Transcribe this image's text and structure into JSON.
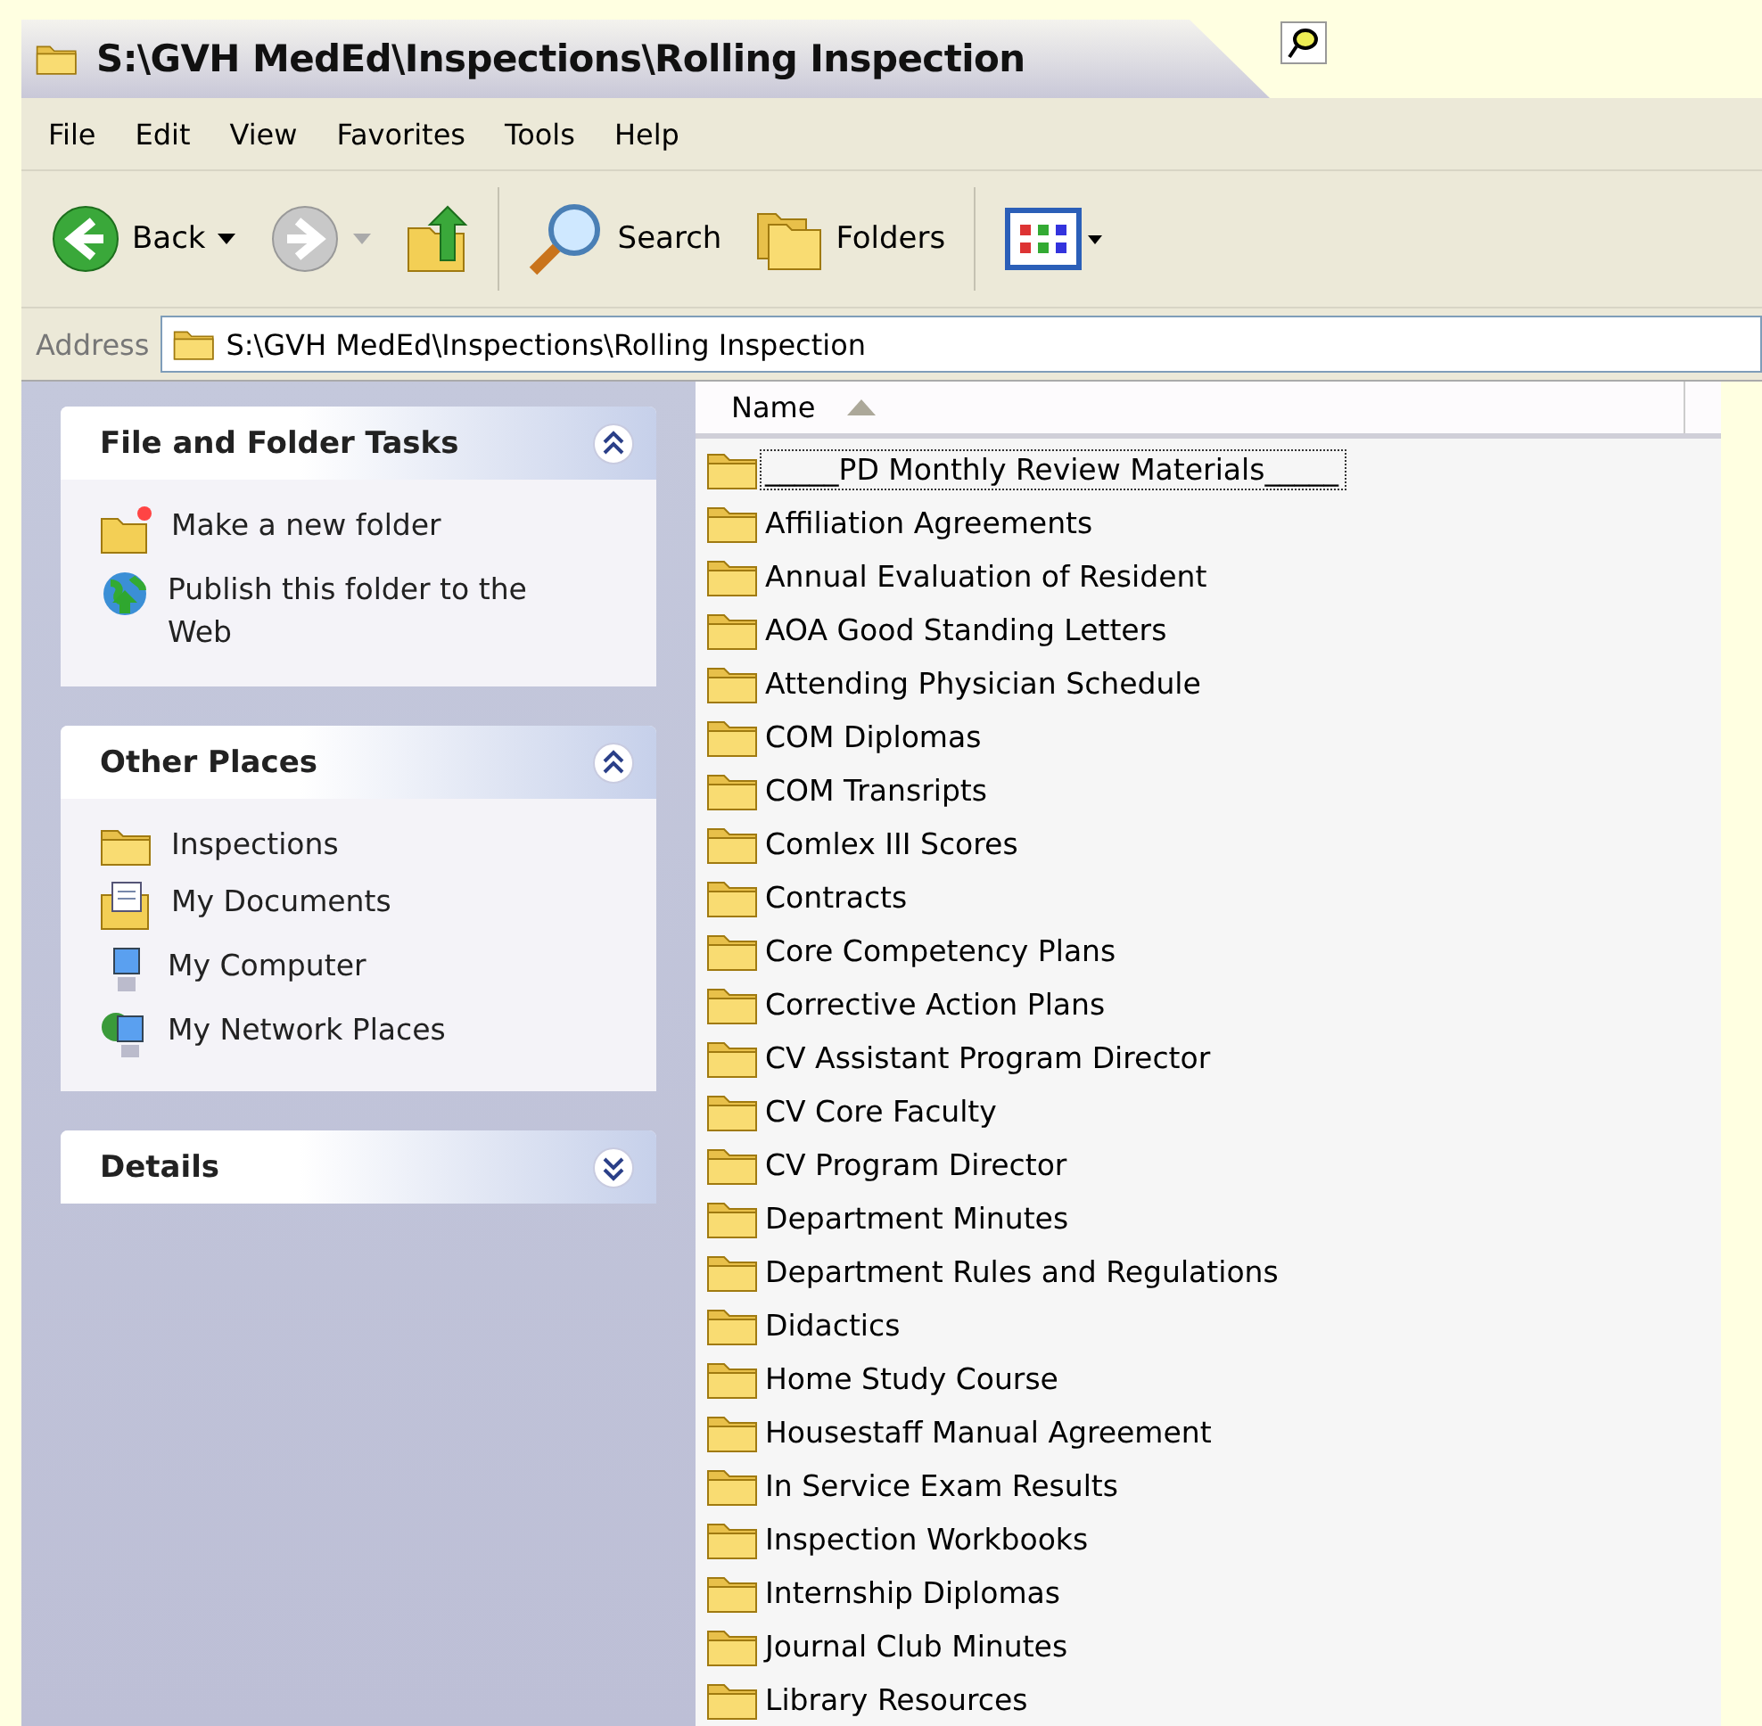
{
  "window": {
    "title": "S:\\GVH MedEd\\Inspections\\Rolling Inspection"
  },
  "menu": [
    "File",
    "Edit",
    "View",
    "Favorites",
    "Tools",
    "Help"
  ],
  "toolbar": [
    {
      "kind": "back",
      "label": "Back"
    },
    {
      "kind": "forward"
    },
    {
      "kind": "up"
    },
    {
      "kind": "search",
      "label": "Search"
    },
    {
      "kind": "folders",
      "label": "Folders"
    },
    {
      "kind": "views"
    }
  ],
  "address": {
    "label": "Address",
    "value": "S:\\GVH MedEd\\Inspections\\Rolling Inspection"
  },
  "panels": [
    {
      "title": "File and Folder Tasks",
      "expanded": true,
      "items": [
        {
          "kind": "newfolder",
          "label": "Make a new folder"
        },
        {
          "kind": "publish",
          "label": "Publish this folder to the Web"
        }
      ]
    },
    {
      "title": "Other Places",
      "expanded": true,
      "items": [
        {
          "kind": "folder",
          "label": "Inspections"
        },
        {
          "kind": "documents",
          "label": "My Documents"
        },
        {
          "kind": "computer",
          "label": "My Computer"
        },
        {
          "kind": "network",
          "label": "My Network Places"
        }
      ]
    },
    {
      "title": "Details",
      "expanded": false
    }
  ],
  "list": {
    "column": "Name",
    "sort_ascending": true,
    "items": [
      {
        "name": "_____PD Monthly Review Materials_____",
        "focused": true
      },
      {
        "name": "Affiliation Agreements",
        "focused": false
      },
      {
        "name": "Annual Evaluation of Resident",
        "focused": false
      },
      {
        "name": "AOA Good Standing Letters",
        "focused": false
      },
      {
        "name": "Attending Physician Schedule",
        "focused": false
      },
      {
        "name": "COM Diplomas",
        "focused": false
      },
      {
        "name": "COM Transripts",
        "focused": false
      },
      {
        "name": "Comlex III Scores",
        "focused": false
      },
      {
        "name": "Contracts",
        "focused": false
      },
      {
        "name": "Core Competency Plans",
        "focused": false
      },
      {
        "name": "Corrective Action Plans",
        "focused": false
      },
      {
        "name": "CV Assistant Program Director",
        "focused": false
      },
      {
        "name": "CV Core Faculty",
        "focused": false
      },
      {
        "name": "CV Program Director",
        "focused": false
      },
      {
        "name": "Department Minutes",
        "focused": false
      },
      {
        "name": "Department Rules and Regulations",
        "focused": false
      },
      {
        "name": "Didactics",
        "focused": false
      },
      {
        "name": "Home Study Course",
        "focused": false
      },
      {
        "name": "Housestaff Manual Agreement",
        "focused": false
      },
      {
        "name": "In Service Exam Results",
        "focused": false
      },
      {
        "name": "Inspection Workbooks",
        "focused": false
      },
      {
        "name": "Internship Diplomas",
        "focused": false
      },
      {
        "name": "Journal Club Minutes",
        "focused": false
      },
      {
        "name": "Library Resources",
        "focused": false
      }
    ]
  }
}
